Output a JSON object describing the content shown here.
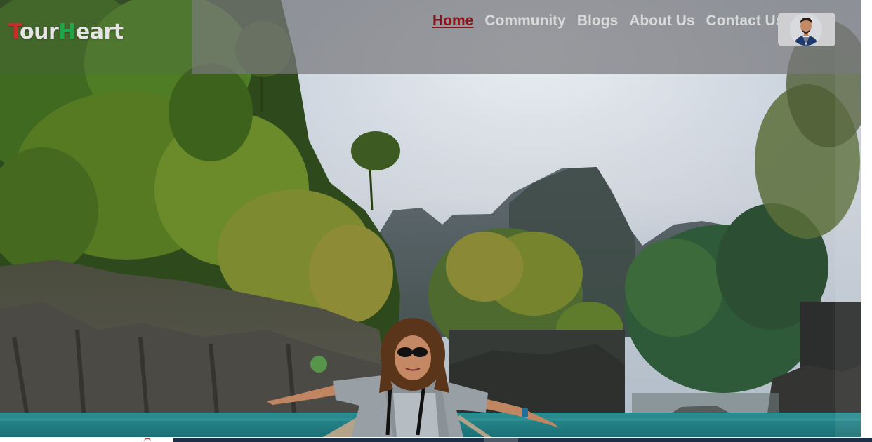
{
  "logo": {
    "first_letter": "T",
    "part1": "our",
    "second_letter": "H",
    "part2": "eart"
  },
  "nav": {
    "items": [
      {
        "label": "Home",
        "active": true
      },
      {
        "label": "Community",
        "active": false
      },
      {
        "label": "Blogs",
        "active": false
      },
      {
        "label": "About Us",
        "active": false
      },
      {
        "label": "Contact Us",
        "active": false
      }
    ]
  },
  "profile": {
    "icon": "user-avatar"
  },
  "colors": {
    "logo_t": "#c62f2b",
    "logo_h": "#21a44a",
    "nav_active": "#8b1418",
    "nav_text": "#d9d9d9",
    "header_overlay": "#78787d"
  }
}
